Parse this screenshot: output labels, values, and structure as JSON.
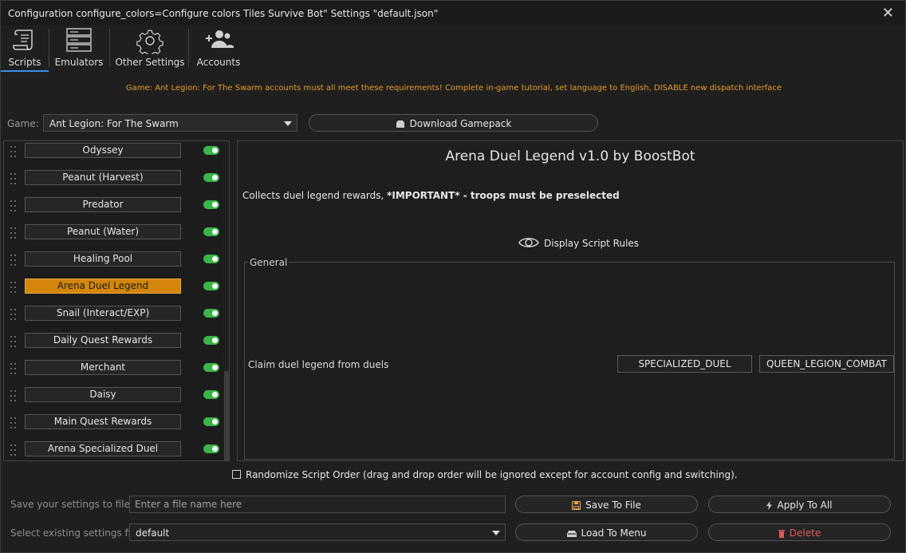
{
  "window": {
    "title": "Configuration configure_colors=Configure colors Tiles Survive Bot\" Settings \"default.json\"",
    "close_icon": "close-icon"
  },
  "nav": {
    "items": [
      {
        "label": "Scripts",
        "icon": "scroll-icon",
        "active": true
      },
      {
        "label": "Emulators",
        "icon": "server-icon"
      },
      {
        "label": "Other Settings",
        "icon": "gear-icon"
      },
      {
        "label": "Accounts",
        "icon": "users-plus-icon"
      }
    ]
  },
  "notice": "Game: Ant Legion: For The Swarm accounts must all meet these requirements! Complete in-game tutorial, set language to English, DISABLE new dispatch interface",
  "game": {
    "label": "Game:",
    "selected": "Ant Legion: For The Swarm",
    "download_label": "Download Gamepack"
  },
  "scripts": [
    {
      "label": "Odyssey",
      "enabled": true
    },
    {
      "label": "Peanut (Harvest)",
      "enabled": true
    },
    {
      "label": "Predator",
      "enabled": true
    },
    {
      "label": "Peanut (Water)",
      "enabled": true
    },
    {
      "label": "Healing Pool",
      "enabled": true
    },
    {
      "label": "Arena Duel Legend",
      "enabled": true,
      "selected": true
    },
    {
      "label": "Snail (Interact/EXP)",
      "enabled": true
    },
    {
      "label": "Daily Quest Rewards",
      "enabled": true
    },
    {
      "label": "Merchant",
      "enabled": true
    },
    {
      "label": "Daisy",
      "enabled": true
    },
    {
      "label": "Main Quest Rewards",
      "enabled": true
    },
    {
      "label": "Arena Specialized Duel",
      "enabled": true
    }
  ],
  "detail": {
    "title": "Arena Duel Legend v1.0 by BoostBot",
    "desc_plain": "Collects duel legend rewards, ",
    "desc_bold": "*IMPORTANT* - troops must be preselected",
    "rules_label": "Display Script Rules",
    "group_label": "General",
    "option_label": "Claim duel legend from duels",
    "option_buttons": [
      "SPECIALIZED_DUEL",
      "QUEEN_LEGION_COMBAT"
    ]
  },
  "randomize_label": "Randomize Script Order (drag and drop order will be ignored except for account config and switching).",
  "footer": {
    "save_label": "Save your settings to file",
    "save_placeholder": "Enter a file name here",
    "save_button": "Save To File",
    "apply_button": "Apply To All",
    "load_label": "Select existing settings file",
    "load_selected": "default",
    "load_button": "Load To Menu",
    "delete_button": "Delete",
    "delete_color": "#e05a5a",
    "accent_color": "#d4860b",
    "notice_color": "#e69a28"
  }
}
